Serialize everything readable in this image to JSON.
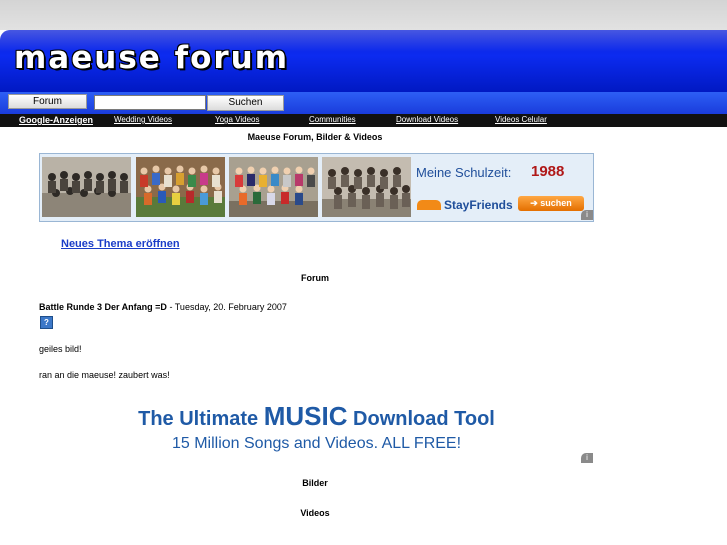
{
  "header": {
    "site_title": "maeuse forum"
  },
  "navbar": {
    "forum_button": "Forum",
    "search_value": "",
    "search_button": "Suchen"
  },
  "adlinks": {
    "lead": "Google-Anzeigen",
    "items": [
      "Wedding Videos",
      "Yoga Videos",
      "Communities",
      "Download Videos",
      "Videos Celular"
    ]
  },
  "page": {
    "subtitle": "Maeuse Forum, Bilder & Videos"
  },
  "ad_stayfriends": {
    "label": "Meine Schulzeit:",
    "year": "1988",
    "brand": "StayFriends",
    "button": "➔ suchen",
    "colors": {
      "label": "#1f4e9a",
      "year": "#b01818",
      "button": "#f28a17"
    }
  },
  "new_thread_link": "Neues Thema eröffnen",
  "sections": {
    "forum": "Forum",
    "bilder": "Bilder",
    "videos": "Videos"
  },
  "post": {
    "title": "Battle Runde 3 Der Anfang =D",
    "date": " - Tuesday, 20. February 2007",
    "icon": "question-icon",
    "lines": [
      "geiles bild!",
      "ran an die maeuse! zaubert was!"
    ]
  },
  "ad_music": {
    "title_pre": "The Ultimate ",
    "title_highlight": "MUSIC",
    "title_post": " Download Tool",
    "subtitle": "15 Million Songs and Videos. ALL FREE!"
  },
  "colors": {
    "banner": "#0c2bf0",
    "nav": "#2d5ff5",
    "adbar": "#111111",
    "link": "#1a3cc8"
  }
}
